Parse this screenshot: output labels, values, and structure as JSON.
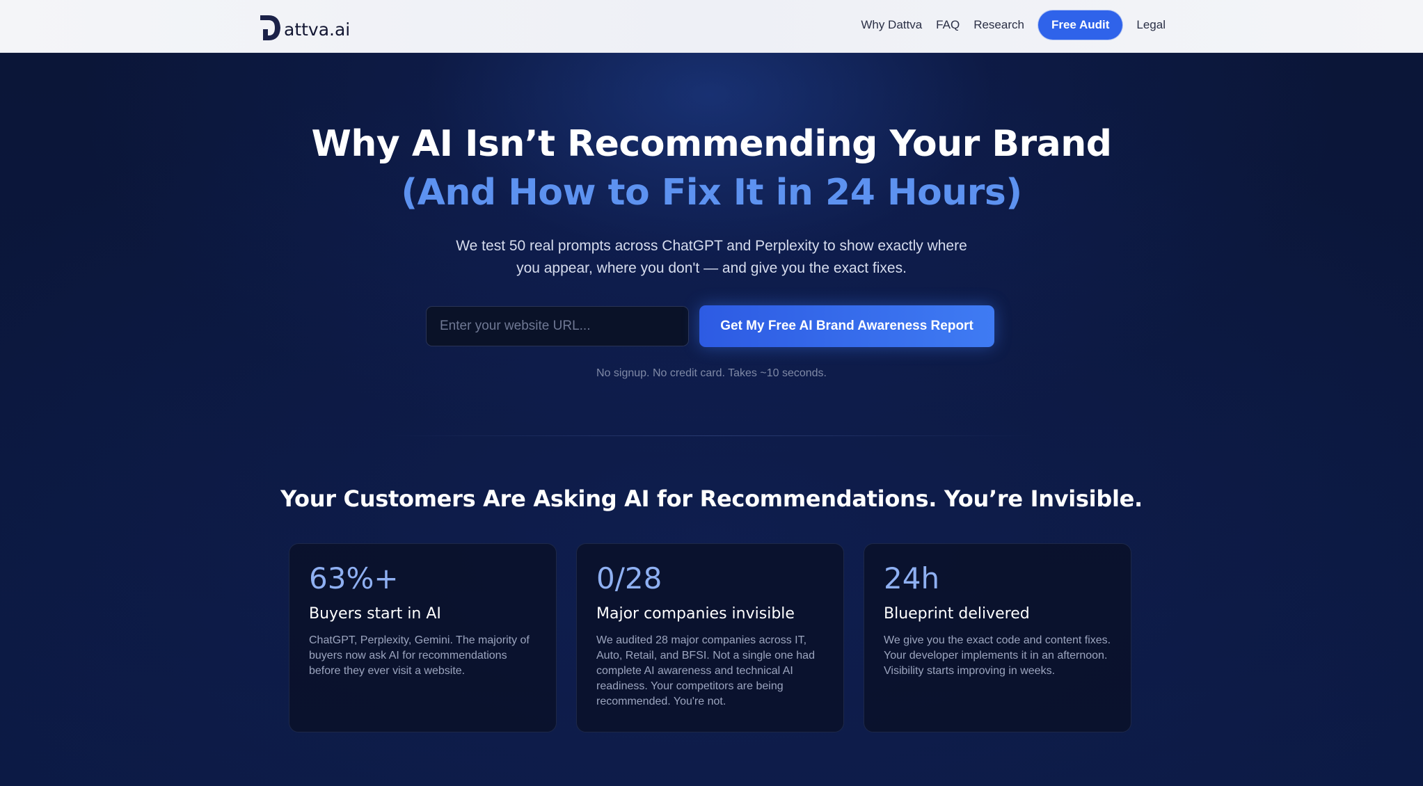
{
  "header": {
    "logo_text": "attva.ai",
    "nav": {
      "why": "Why Dattva",
      "faq": "FAQ",
      "research": "Research",
      "cta": "Free Audit",
      "legal": "Legal"
    }
  },
  "hero": {
    "title_line1": "Why AI Isn’t Recommending Your Brand",
    "title_line2": "(And How to Fix It in 24 Hours)",
    "subtitle_line1": "We test 50 real prompts across ChatGPT and Perplexity to show exactly where",
    "subtitle_line2": "you appear, where you don't — and give you the exact fixes.",
    "input_placeholder": "Enter your website URL...",
    "submit_label": "Get My Free AI Brand Awareness Report",
    "note": "No signup. No credit card. Takes ~10 seconds."
  },
  "section": {
    "title": "Your Customers Are Asking AI for Recommendations. You’re Invisible.",
    "cards": [
      {
        "stat": "63%+",
        "title": "Buyers start in AI",
        "body": "ChatGPT, Perplexity, Gemini. The majority of buyers now ask AI for recommendations before they ever visit a website."
      },
      {
        "stat": "0/28",
        "title": "Major companies invisible",
        "body": "We audited 28 major companies across IT, Auto, Retail, and BFSI. Not a single one had complete AI awareness and technical AI readiness. Your competitors are being recommended. You're not."
      },
      {
        "stat": "24h",
        "title": "Blueprint delivered",
        "body": "We give you the exact code and content fixes. Your developer implements it in an afternoon. Visibility starts improving in weeks."
      }
    ]
  },
  "colors": {
    "accent": "#2f63ea",
    "title_accent": "#5d92f0",
    "stat": "#8fb0f2",
    "background": "#0b1638"
  }
}
